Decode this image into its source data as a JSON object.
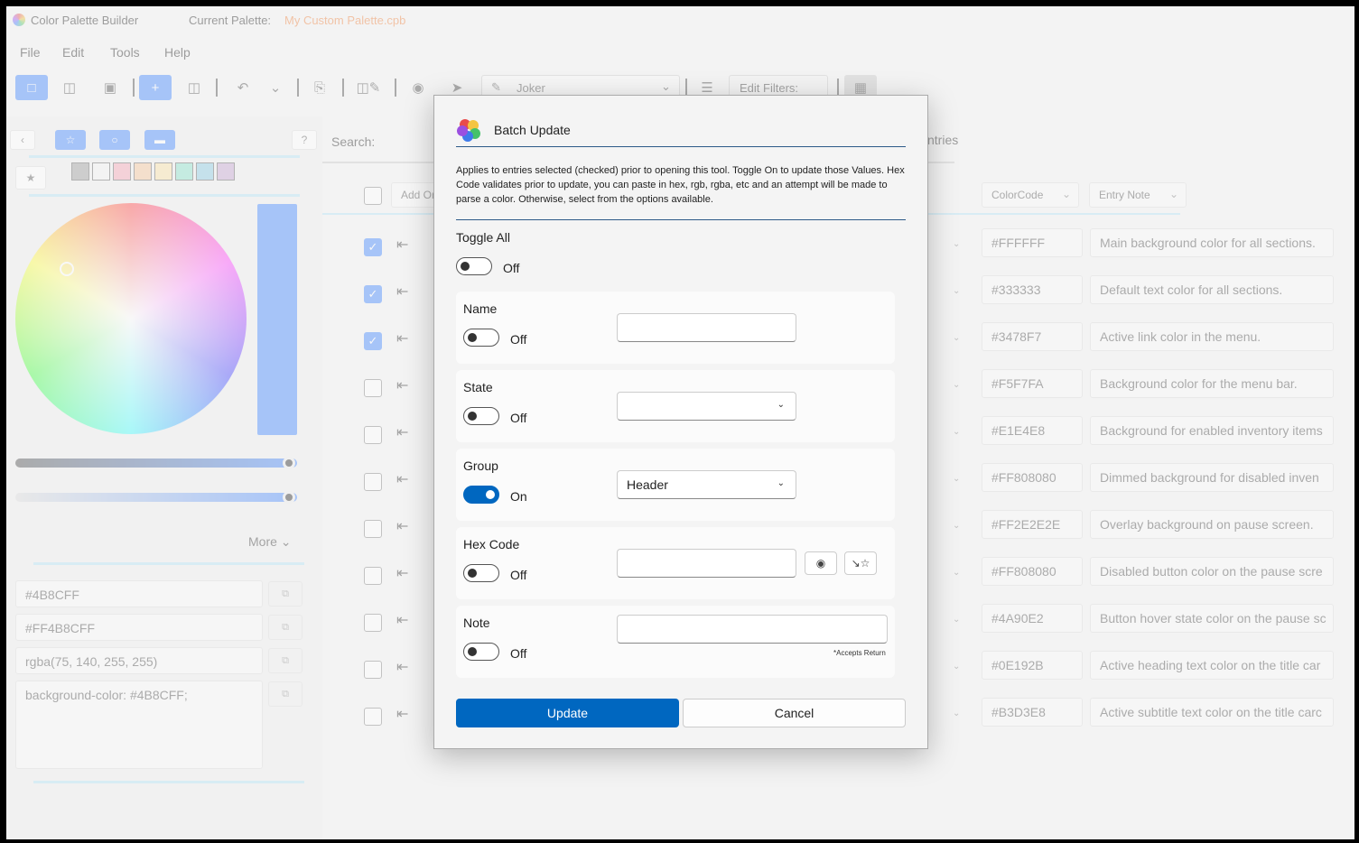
{
  "titlebar": {
    "app_title": "Color Palette Builder",
    "palette_caption": "Current Palette:",
    "palette_name": "My Custom Palette.cpb"
  },
  "menu": [
    "File",
    "Edit",
    "Tools",
    "Help"
  ],
  "toolbar": {
    "joker_label": "Joker",
    "edit_filters_label": "Edit Filters:"
  },
  "left_panel": {
    "swatches": [
      "#a0a0a0",
      "#f5f5f5",
      "#f6a9b9",
      "#f7c89e",
      "#fbe3a9",
      "#8fe2cc",
      "#8ecde3",
      "#c9a8d2"
    ],
    "current_color": "#4B8CFF",
    "more_label": "More",
    "codes": [
      "#4B8CFF",
      "#FF4B8CFF",
      "rgba(75, 140, 255, 255)",
      "background-color: #4B8CFF;"
    ]
  },
  "table": {
    "search_label": "Search:",
    "entries_label": "ntries",
    "headers": {
      "add_order": "Add Or",
      "color_code": "ColorCode",
      "entry_note": "Entry Note"
    },
    "rows": [
      {
        "checked": true,
        "code": "#FFFFFF",
        "note": "Main background color for all sections."
      },
      {
        "checked": true,
        "code": "#333333",
        "note": "Default text color for all sections."
      },
      {
        "checked": true,
        "code": "#3478F7",
        "note": "Active link color in the menu."
      },
      {
        "checked": false,
        "code": "#F5F7FA",
        "note": "Background color for the menu bar."
      },
      {
        "checked": false,
        "code": "#E1E4E8",
        "note": "Background for enabled inventory items"
      },
      {
        "checked": false,
        "code": "#FF808080",
        "note": "Dimmed background for disabled inven"
      },
      {
        "checked": false,
        "code": "#FF2E2E2E",
        "note": "Overlay background on pause screen."
      },
      {
        "checked": false,
        "code": "#FF808080",
        "note": "Disabled button color on the pause scre"
      },
      {
        "checked": false,
        "code": "#4A90E2",
        "note": "Button hover state color on the pause sc"
      },
      {
        "checked": false,
        "code": "#0E192B",
        "note": "Active heading text color on the title car"
      },
      {
        "checked": false,
        "code": "#B3D3E8",
        "note": "Active subtitle text color on the title carc"
      }
    ]
  },
  "dialog": {
    "title": "Batch Update",
    "description": "Applies to entries selected (checked) prior to opening this tool. Toggle On to update those Values. Hex Code validates prior to update, you can paste in hex, rgb, rgba, etc and an attempt will be made to parse a color. Otherwise, select from the options available.",
    "toggle_all": {
      "label": "Toggle All",
      "state": "Off"
    },
    "name": {
      "label": "Name",
      "state": "Off",
      "value": ""
    },
    "state": {
      "label": "State",
      "state": "Off",
      "value": ""
    },
    "group": {
      "label": "Group",
      "state": "On",
      "value": "Header"
    },
    "hex_code": {
      "label": "Hex Code",
      "state": "Off",
      "value": ""
    },
    "note": {
      "label": "Note",
      "state": "Off",
      "value": "",
      "hint": "*Accepts Return"
    },
    "update_label": "Update",
    "cancel_label": "Cancel"
  }
}
